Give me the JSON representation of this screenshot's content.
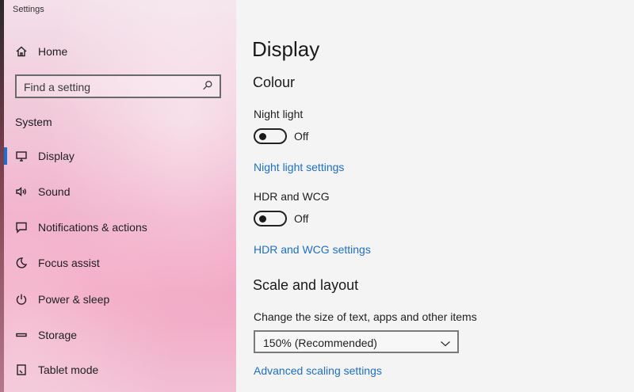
{
  "window": {
    "title": "Settings"
  },
  "sidebar": {
    "home_label": "Home",
    "search": {
      "placeholder": "Find a setting",
      "value": ""
    },
    "section_label": "System",
    "items": [
      {
        "label": "Display",
        "icon": "monitor-icon",
        "active": true
      },
      {
        "label": "Sound",
        "icon": "speaker-icon"
      },
      {
        "label": "Notifications & actions",
        "icon": "message-icon"
      },
      {
        "label": "Focus assist",
        "icon": "moon-icon"
      },
      {
        "label": "Power & sleep",
        "icon": "power-icon"
      },
      {
        "label": "Storage",
        "icon": "storage-icon"
      },
      {
        "label": "Tablet mode",
        "icon": "tablet-icon"
      }
    ]
  },
  "main": {
    "title": "Display",
    "colour_heading": "Colour",
    "night_light": {
      "label": "Night light",
      "state": "Off",
      "link": "Night light settings"
    },
    "hdr": {
      "label": "HDR and WCG",
      "state": "Off",
      "link": "HDR and WCG settings"
    },
    "scale": {
      "heading": "Scale and layout",
      "label": "Change the size of text, apps and other items",
      "selected": "150% (Recommended)",
      "link": "Advanced scaling settings"
    }
  },
  "colors": {
    "accent": "#1a6fd6",
    "link": "#1f6fc4"
  }
}
